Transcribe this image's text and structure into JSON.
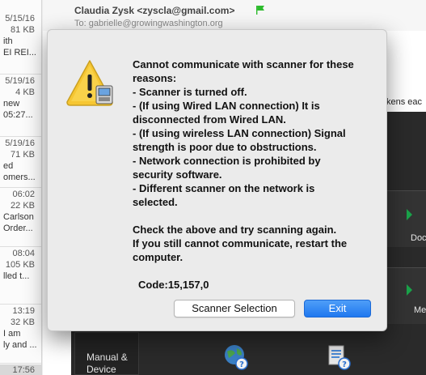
{
  "mail_list": {
    "items": [
      {
        "lines": [
          {
            "text": "5/15/16",
            "align": "right"
          },
          {
            "text": "81 KB",
            "align": "right"
          },
          {
            "text": "ith",
            "align": "left"
          },
          {
            "text": "EI REI...",
            "align": "left"
          }
        ]
      },
      {
        "lines": [
          {
            "text": "5/19/16",
            "align": "right"
          },
          {
            "text": "4 KB",
            "align": "right"
          },
          {
            "text": "new",
            "align": "left"
          },
          {
            "text": "05:27...",
            "align": "left"
          }
        ]
      },
      {
        "lines": [
          {
            "text": "5/19/16",
            "align": "right"
          },
          {
            "text": "71 KB",
            "align": "right"
          },
          {
            "text": "ed",
            "align": "left"
          },
          {
            "text": "omers...",
            "align": "left"
          }
        ]
      },
      {
        "lines": [
          {
            "text": "06:02",
            "align": "right"
          },
          {
            "text": "22 KB",
            "align": "right"
          },
          {
            "text": "Carlson",
            "align": "left"
          },
          {
            "text": "Order...",
            "align": "left"
          }
        ]
      },
      {
        "lines": [
          {
            "text": "08:04",
            "align": "right"
          },
          {
            "text": "105 KB",
            "align": "right"
          },
          {
            "text": "",
            "align": "left"
          },
          {
            "text": "lled t...",
            "align": "left"
          }
        ]
      },
      {
        "lines": [
          {
            "text": "13:19",
            "align": "right"
          },
          {
            "text": "32 KB",
            "align": "right"
          },
          {
            "text": "I am",
            "align": "left"
          },
          {
            "text": "ly and ...",
            "align": "left"
          }
        ]
      },
      {
        "lines": [
          {
            "text": "17:56",
            "align": "right"
          }
        ]
      }
    ]
  },
  "mail_header": {
    "from": "Claudia Zysk <zyscla@gmail.com>",
    "to": "To:   gabrielle@growingwashington.org",
    "flag_color": "#2dbb2d"
  },
  "behind_text": "kens eac",
  "scanner_app": {
    "sidebar_label_1": "Manual &",
    "sidebar_label_2": "Device",
    "side_label_1": "Doc",
    "side_label_2": "Me"
  },
  "dialog": {
    "icon": "caution-scanner-icon",
    "message_lines": [
      "Cannot communicate with scanner for these",
      "reasons:",
      "- Scanner is turned off.",
      "- (If using Wired LAN connection) It is",
      "disconnected from Wired LAN.",
      "- (If using wireless LAN connection) Signal",
      "strength is poor due to obstructions.",
      "- Network connection is prohibited by",
      "security software.",
      "- Different scanner on the network is",
      "selected.",
      "",
      "Check the above and try scanning again.",
      "If you still cannot communicate, restart the",
      "computer."
    ],
    "code": "Code:15,157,0",
    "scanner_selection_label": "Scanner Selection",
    "exit_label": "Exit",
    "accent_color": "#2a82f4"
  }
}
